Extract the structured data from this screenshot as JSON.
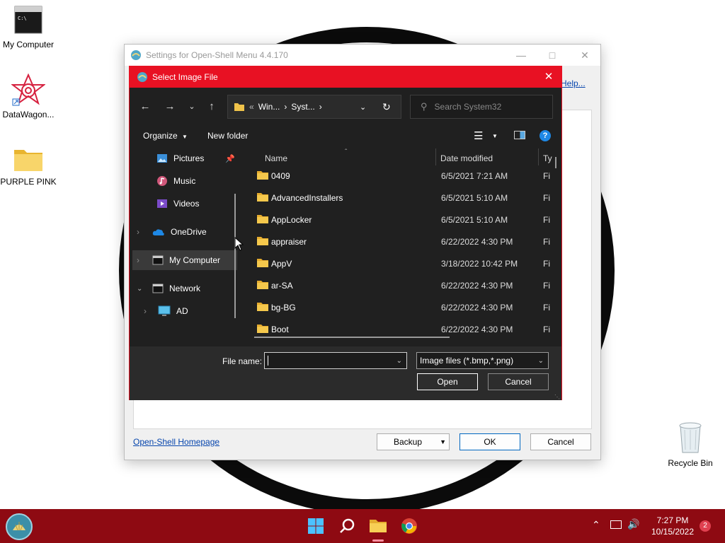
{
  "desktop": {
    "icons": [
      {
        "label": "My Computer"
      },
      {
        "label": "DataWagon..."
      },
      {
        "label": "PURPLE PINK"
      },
      {
        "label": "Recycle Bin"
      }
    ]
  },
  "settings_window": {
    "title": "Settings for Open-Shell Menu 4.4.170",
    "help_link": "Help...",
    "homepage_link": "Open-Shell Homepage",
    "backup_label": "Backup",
    "ok_label": "OK",
    "cancel_label": "Cancel"
  },
  "dialog": {
    "title": "Select Image File",
    "address": {
      "crumbs": [
        "Win...",
        "Syst..."
      ]
    },
    "search_placeholder": "Search System32",
    "toolbar": {
      "organize": "Organize",
      "new_folder": "New folder"
    },
    "nav_items": [
      {
        "label": "Pictures"
      },
      {
        "label": "Music"
      },
      {
        "label": "Videos"
      },
      {
        "label": "OneDrive"
      },
      {
        "label": "My Computer"
      },
      {
        "label": "Network"
      },
      {
        "label": "AD"
      }
    ],
    "columns": {
      "name": "Name",
      "date": "Date modified",
      "type": "Ty"
    },
    "rows": [
      {
        "name": "0409",
        "date": "6/5/2021 7:21 AM",
        "type": "Fi"
      },
      {
        "name": "AdvancedInstallers",
        "date": "6/5/2021 5:10 AM",
        "type": "Fi"
      },
      {
        "name": "AppLocker",
        "date": "6/5/2021 5:10 AM",
        "type": "Fi"
      },
      {
        "name": "appraiser",
        "date": "6/22/2022 4:30 PM",
        "type": "Fi"
      },
      {
        "name": "AppV",
        "date": "3/18/2022 10:42 PM",
        "type": "Fi"
      },
      {
        "name": "ar-SA",
        "date": "6/22/2022 4:30 PM",
        "type": "Fi"
      },
      {
        "name": "bg-BG",
        "date": "6/22/2022 4:30 PM",
        "type": "Fi"
      },
      {
        "name": "Boot",
        "date": "6/22/2022 4:30 PM",
        "type": "Fi"
      }
    ],
    "filename_label": "File name:",
    "filename_value": "",
    "filetype": "Image files (*.bmp,*.png)",
    "open_label": "Open",
    "cancel_label": "Cancel"
  },
  "taskbar": {
    "time": "7:27 PM",
    "date": "10/15/2022",
    "notification_count": "2"
  },
  "colors": {
    "dialog_accent": "#e81123",
    "taskbar": "#8e0a12",
    "dialog_bg": "#202020"
  }
}
